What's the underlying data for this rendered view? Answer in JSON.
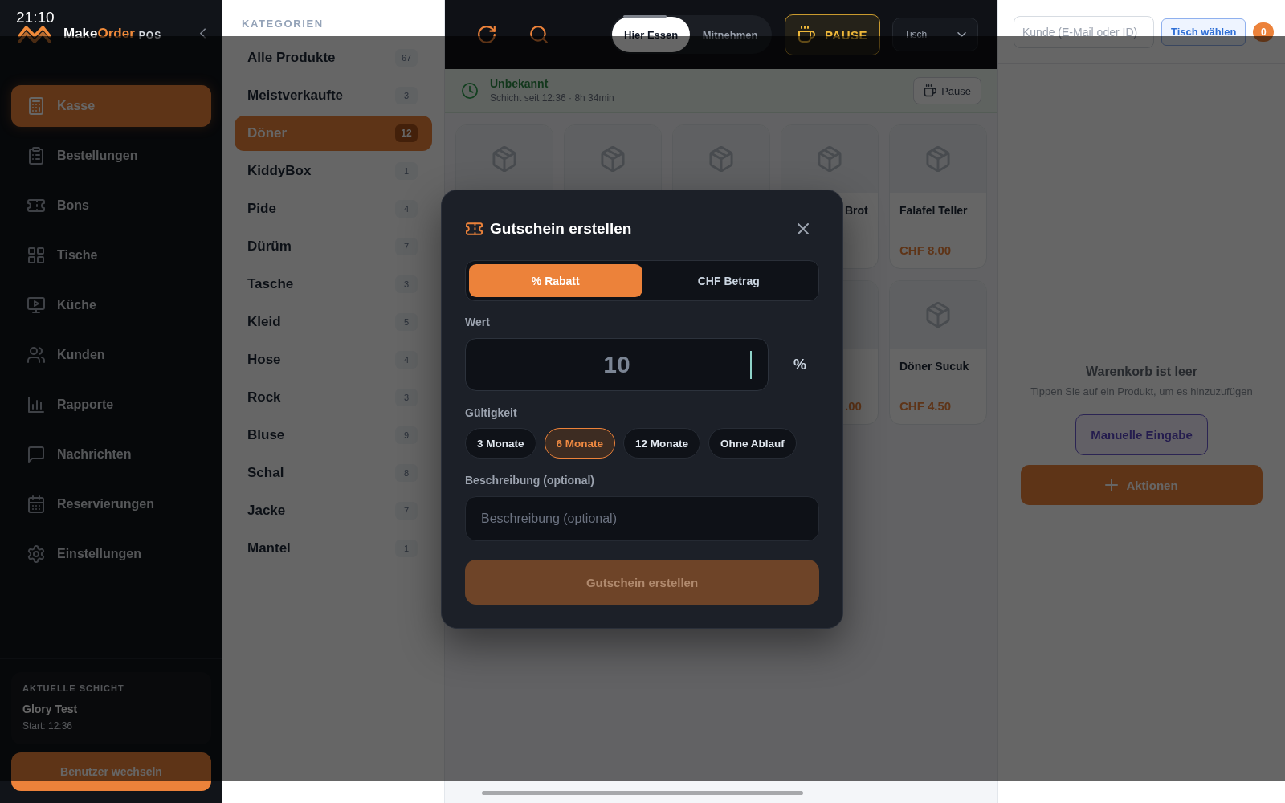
{
  "status_bar": {
    "time": "21:10"
  },
  "sidebar": {
    "brand": {
      "name_start": "Make",
      "name_accent": "Order",
      "suffix": "POS"
    },
    "items": [
      {
        "label": "Kasse",
        "selected": true
      },
      {
        "label": "Bestellungen",
        "selected": false
      },
      {
        "label": "Bons",
        "selected": false
      },
      {
        "label": "Tische",
        "selected": false
      },
      {
        "label": "Küche",
        "selected": false
      },
      {
        "label": "Kunden",
        "selected": false
      },
      {
        "label": "Rapporte",
        "selected": false
      },
      {
        "label": "Nachrichten",
        "selected": false
      },
      {
        "label": "Reservierungen",
        "selected": false
      },
      {
        "label": "Einstellungen",
        "selected": false
      }
    ],
    "current_shift": {
      "title": "AKTUELLE SCHICHT",
      "user": "Glory Test",
      "start": "Start: 12:36"
    },
    "switch_user_button": "Benutzer wechseln"
  },
  "categories": {
    "title": "KATEGORIEN",
    "items": [
      {
        "label": "Alle Produkte",
        "count": "67",
        "selected": false
      },
      {
        "label": "Meistverkaufte",
        "count": "3",
        "selected": false
      },
      {
        "label": "Döner",
        "count": "12",
        "selected": true
      },
      {
        "label": "KiddyBox",
        "count": "1",
        "selected": false
      },
      {
        "label": "Pide",
        "count": "4",
        "selected": false
      },
      {
        "label": "Dürüm",
        "count": "7",
        "selected": false
      },
      {
        "label": "Tasche",
        "count": "3",
        "selected": false
      },
      {
        "label": "Kleid",
        "count": "5",
        "selected": false
      },
      {
        "label": "Hose",
        "count": "4",
        "selected": false
      },
      {
        "label": "Rock",
        "count": "3",
        "selected": false
      },
      {
        "label": "Bluse",
        "count": "9",
        "selected": false
      },
      {
        "label": "Schal",
        "count": "8",
        "selected": false
      },
      {
        "label": "Jacke",
        "count": "7",
        "selected": false
      },
      {
        "label": "Mantel",
        "count": "1",
        "selected": false
      }
    ]
  },
  "top_bar": {
    "order_types": [
      {
        "label": "Hier Essen",
        "selected": true
      },
      {
        "label": "Mitnehmen",
        "selected": false
      }
    ],
    "pause_button": "PAUSE",
    "table_select": {
      "label": "Tisch",
      "value": "—"
    }
  },
  "shift_bar": {
    "user": "Unbekannt",
    "info": "Schicht seit 12:36 · 8h 34min",
    "pause_button": "Pause"
  },
  "product_grid": {
    "rows": [
      {
        "cards": [
          {
            "kind": "top"
          },
          {
            "kind": "top"
          },
          {
            "kind": "top"
          },
          {
            "kind": "edge",
            "name": "Brot"
          },
          {
            "kind": "full",
            "name": "Falafel Teller",
            "price": "CHF 8.00"
          }
        ]
      },
      {
        "cards": [
          {
            "kind": "edge",
            "price": ".00"
          },
          {
            "kind": "full",
            "name": "Döner Sucuk",
            "price": "CHF 4.50"
          }
        ]
      }
    ]
  },
  "cart": {
    "customer_field": {
      "placeholder": "Kunde (E-Mail oder ID)"
    },
    "table_button": "Tisch wählen",
    "item_count": "0",
    "empty_title": "Warenkorb ist leer",
    "empty_hint": "Tippen Sie auf ein Produkt, um es hinzuzufügen",
    "manual_entry_button": "Manuelle Eingabe",
    "actions_button": "Aktionen"
  },
  "voucher_dialog": {
    "title": "Gutschein erstellen",
    "type_tabs": [
      {
        "label": "% Rabatt",
        "selected": true
      },
      {
        "label": "CHF Betrag",
        "selected": false
      }
    ],
    "value_label": "Wert",
    "value_field": {
      "value": "10",
      "focused": true
    },
    "unit": "%",
    "validity_label": "Gültigkeit",
    "validity_options": [
      {
        "label": "3 Monate",
        "selected": false
      },
      {
        "label": "6 Monate",
        "selected": true
      },
      {
        "label": "12 Monate",
        "selected": false
      },
      {
        "label": "Ohne Ablauf",
        "selected": false
      }
    ],
    "description_label": "Beschreibung (optional)",
    "description_field": {
      "placeholder": "Beschreibung (optional)"
    },
    "submit_button": {
      "label": "Gutschein erstellen",
      "disabled": true
    }
  }
}
